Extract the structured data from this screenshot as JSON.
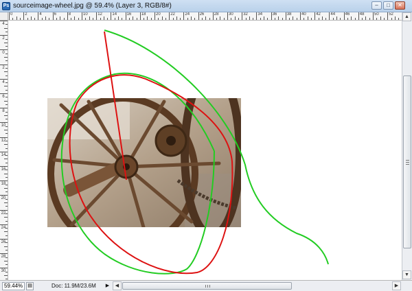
{
  "window": {
    "title": "sourceimage-wheel.jpg @ 59.4% (Layer 3, RGB/8#)",
    "app_icon": "Ps",
    "minimize_icon": "minimize-icon",
    "maximize_icon": "maximize-icon",
    "close_icon": "close-icon"
  },
  "ruler_top": {
    "labels": [
      "0",
      "2",
      "4",
      "6",
      "8",
      "10",
      "12",
      "14",
      "16",
      "18",
      "20",
      "22",
      "24",
      "26",
      "28",
      "30",
      "32",
      "34",
      "36",
      "38",
      "40",
      "42",
      "44",
      "46",
      "48",
      "50",
      "52",
      "54"
    ]
  },
  "ruler_left": {
    "labels": [
      "4",
      "2",
      "0",
      "2",
      "4",
      "6",
      "8",
      "10",
      "12",
      "14",
      "16",
      "18",
      "20",
      "22",
      "24",
      "26",
      "28",
      "30"
    ]
  },
  "canvas": {
    "image_name": "rusty-wheel-photo",
    "strokes": [
      {
        "name": "green-freehand-stroke",
        "color": "#22cc22"
      },
      {
        "name": "red-ellipse-stroke",
        "color": "#dd1111"
      }
    ]
  },
  "status": {
    "zoom": "59.44%",
    "doc_info": "Doc: 11.9M/23.6M",
    "arrow_glyph": "▶"
  },
  "scrollbar": {
    "up_arrow": "▲",
    "down_arrow": "▼",
    "left_arrow": "◀",
    "right_arrow": "▶"
  }
}
